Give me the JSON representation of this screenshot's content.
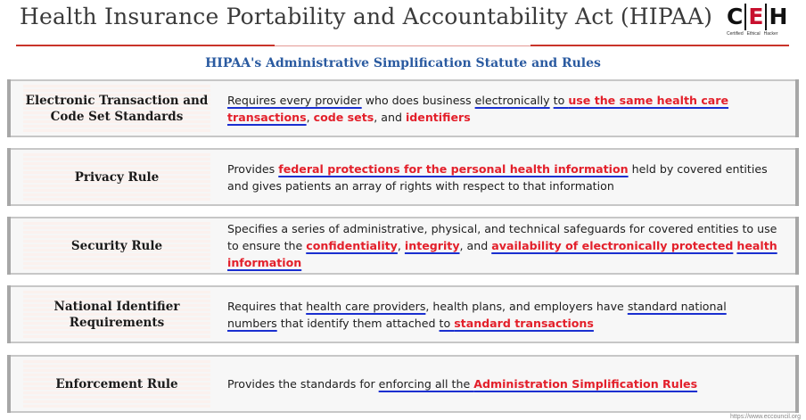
{
  "header": {
    "title": "Health Insurance Portability and Accountability Act (HIPAA)",
    "logo_letters": [
      "C",
      "E",
      "H"
    ],
    "logo_sub": [
      "Certified",
      "Ethical",
      "Hacker"
    ]
  },
  "subtitle": "HIPAA's Administrative Simplification Statute and Rules",
  "rows": [
    {
      "title": "Electronic Transaction and Code Set Standards",
      "desc": [
        {
          "t": "Requires every provider",
          "s": "u"
        },
        {
          "t": " who does business ",
          "s": ""
        },
        {
          "t": "electronically",
          "s": "u"
        },
        {
          "t": " ",
          "s": ""
        },
        {
          "t": "to ",
          "s": "u"
        },
        {
          "t": "use the same health care transactions",
          "s": "hu"
        },
        {
          "t": ", ",
          "s": ""
        },
        {
          "t": "code sets",
          "s": "h"
        },
        {
          "t": ", and ",
          "s": ""
        },
        {
          "t": "identifiers",
          "s": "h"
        }
      ]
    },
    {
      "title": "Privacy Rule",
      "desc": [
        {
          "t": "Provides ",
          "s": ""
        },
        {
          "t": "federal protections for the personal health information",
          "s": "hu"
        },
        {
          "t": " held by covered entities and gives patients an array of rights with respect to that information",
          "s": ""
        }
      ]
    },
    {
      "title": "Security Rule",
      "desc": [
        {
          "t": "Specifies a series of administrative, physical, and technical safeguards for covered entities to use to ensure the ",
          "s": ""
        },
        {
          "t": "confidentiality",
          "s": "hu"
        },
        {
          "t": ", ",
          "s": ""
        },
        {
          "t": "integrity",
          "s": "hu"
        },
        {
          "t": ", and ",
          "s": ""
        },
        {
          "t": "availability of electronically protected",
          "s": "hu"
        },
        {
          "t": " ",
          "s": ""
        },
        {
          "t": "health information",
          "s": "hu"
        }
      ]
    },
    {
      "title": "National Identifier Requirements",
      "desc": [
        {
          "t": "Requires that ",
          "s": ""
        },
        {
          "t": "health care providers",
          "s": "u"
        },
        {
          "t": ", health plans, and employers have ",
          "s": ""
        },
        {
          "t": "standard national numbers",
          "s": "u"
        },
        {
          "t": " that identify them attached ",
          "s": ""
        },
        {
          "t": "to ",
          "s": "u"
        },
        {
          "t": "standard transactions",
          "s": "hu"
        }
      ]
    },
    {
      "title": "Enforcement Rule",
      "desc": [
        {
          "t": "Provides the standards for ",
          "s": ""
        },
        {
          "t": "enforcing all the ",
          "s": "u"
        },
        {
          "t": "Administration Simplification Rules",
          "s": "hu"
        }
      ]
    }
  ],
  "colors": {
    "title_text": "#3a3a3a",
    "rule": "#c9342a",
    "subtitle_text": "#2a5aa0",
    "highlight_text": "#e3202b",
    "ink_underline": "#1a2fd0"
  },
  "footer_url": "https://www.eccouncil.org"
}
